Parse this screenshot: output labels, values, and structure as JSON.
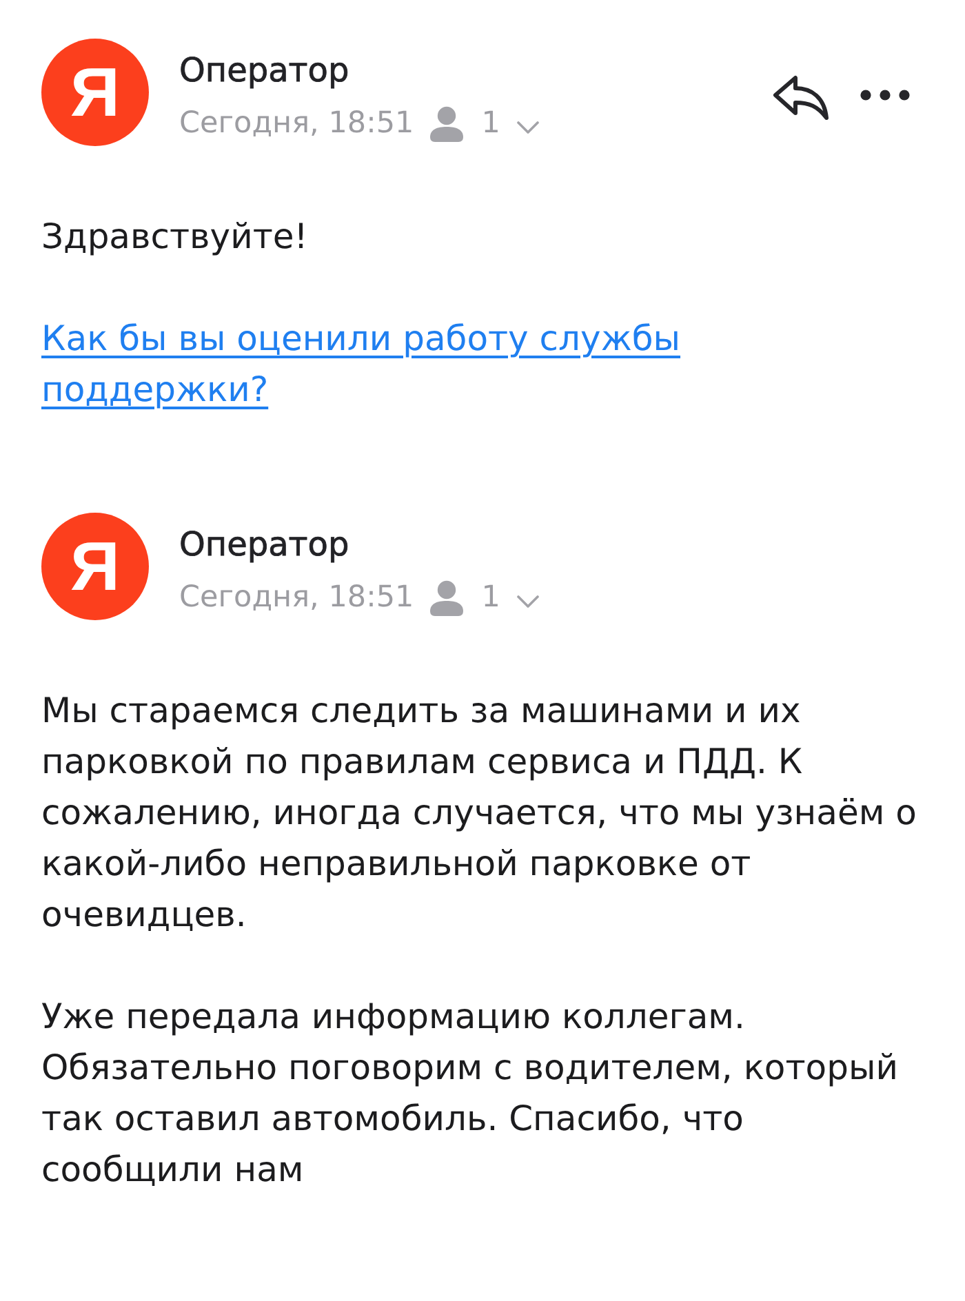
{
  "messages": [
    {
      "avatar_letter": "Я",
      "sender": "Оператор",
      "date": "Сегодня, 18:51",
      "recipients_count": "1",
      "actions_visible": true,
      "body": [
        {
          "kind": "text",
          "text": "Здравствуйте!"
        },
        {
          "kind": "link",
          "text": "Как бы вы оценили работу службы поддержки?"
        }
      ]
    },
    {
      "avatar_letter": "Я",
      "sender": "Оператор",
      "date": "Сегодня, 18:51",
      "recipients_count": "1",
      "actions_visible": false,
      "body": [
        {
          "kind": "text",
          "text": "Мы стараемся следить за машинами и их парковкой по правилам сервиса и ПДД. К сожалению, иногда случается, что мы узнаём о какой-либо неправильной парковке от очевидцев."
        },
        {
          "kind": "text",
          "text": "Уже передала информацию коллегам. Обязательно поговорим с водителем, который так оставил автомобиль. Спасибо, что сообщили нам"
        }
      ]
    }
  ]
}
